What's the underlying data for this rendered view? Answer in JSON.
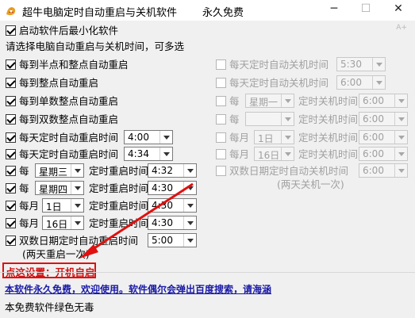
{
  "window": {
    "title": "超牛电脑定时自动重启与关机软件",
    "free_label": "永久免费",
    "minimize": "─",
    "maximize": "☐",
    "close": "✕",
    "corner_mark": "A+"
  },
  "options": {
    "start_minimized": "启动软件后最小化软件",
    "instruction": "请选择电脑自动重启与关机时间，可多选"
  },
  "restart": {
    "half_hour": "每到半点和整点自动重启",
    "whole_hour": "每到整点自动重启",
    "odd_hour": "每到单数整点自动重启",
    "even_hour": "每到双数整点自动重启",
    "daily_1": {
      "label": "每天定时自动重启时间",
      "time": "4:00"
    },
    "daily_2": {
      "label": "每天定时自动重启时间",
      "time": "4:34"
    },
    "weekly_1": {
      "prefix": "每",
      "day": "星期三",
      "label": "定时重启时间",
      "time": "4:32"
    },
    "weekly_2": {
      "prefix": "每",
      "day": "星期四",
      "label": "定时重启时间",
      "time": "4:30"
    },
    "monthly_1": {
      "prefix": "每月",
      "day": "1日",
      "label": "定时重启时间",
      "time": "4:30"
    },
    "monthly_2": {
      "prefix": "每月",
      "day": "16日",
      "label": "定时重启时间",
      "time": "4:30"
    },
    "even_day": {
      "label": "双数日期定时自动重启时间",
      "time": "5:00",
      "note": "(两天重启一次)"
    }
  },
  "shutdown": {
    "daily_1": {
      "label": "每天定时自动关机时间",
      "time": "5:30"
    },
    "daily_2": {
      "label": "每天定时自动关机时间",
      "time": "6:00"
    },
    "weekly": {
      "prefix": "每",
      "day": "星期一",
      "label": "定时关机时间",
      "time": "6:00"
    },
    "weekly_2": {
      "prefix": "每",
      "label": "定时关机时间",
      "time": "6:00"
    },
    "monthly_1": {
      "prefix": "每月",
      "day": "1日",
      "label": "定时关机时间",
      "time": "6:00"
    },
    "monthly_2": {
      "prefix": "每月",
      "day": "16日",
      "label": "定时关机时间",
      "time": "6:00"
    },
    "even_day": {
      "label": "双数日期定时自动关机时间",
      "time": "6:00",
      "note": "(两天关机一次)"
    }
  },
  "hint": "点这设置：开机自启",
  "notice_link": "本软件永久免费，欢迎使用。软件偶尔会弹出百度搜索，请海涵",
  "footer": "本免费软件绿色无毒",
  "colors": {
    "annotation": "#e01010",
    "link": "#1a1aa6"
  }
}
